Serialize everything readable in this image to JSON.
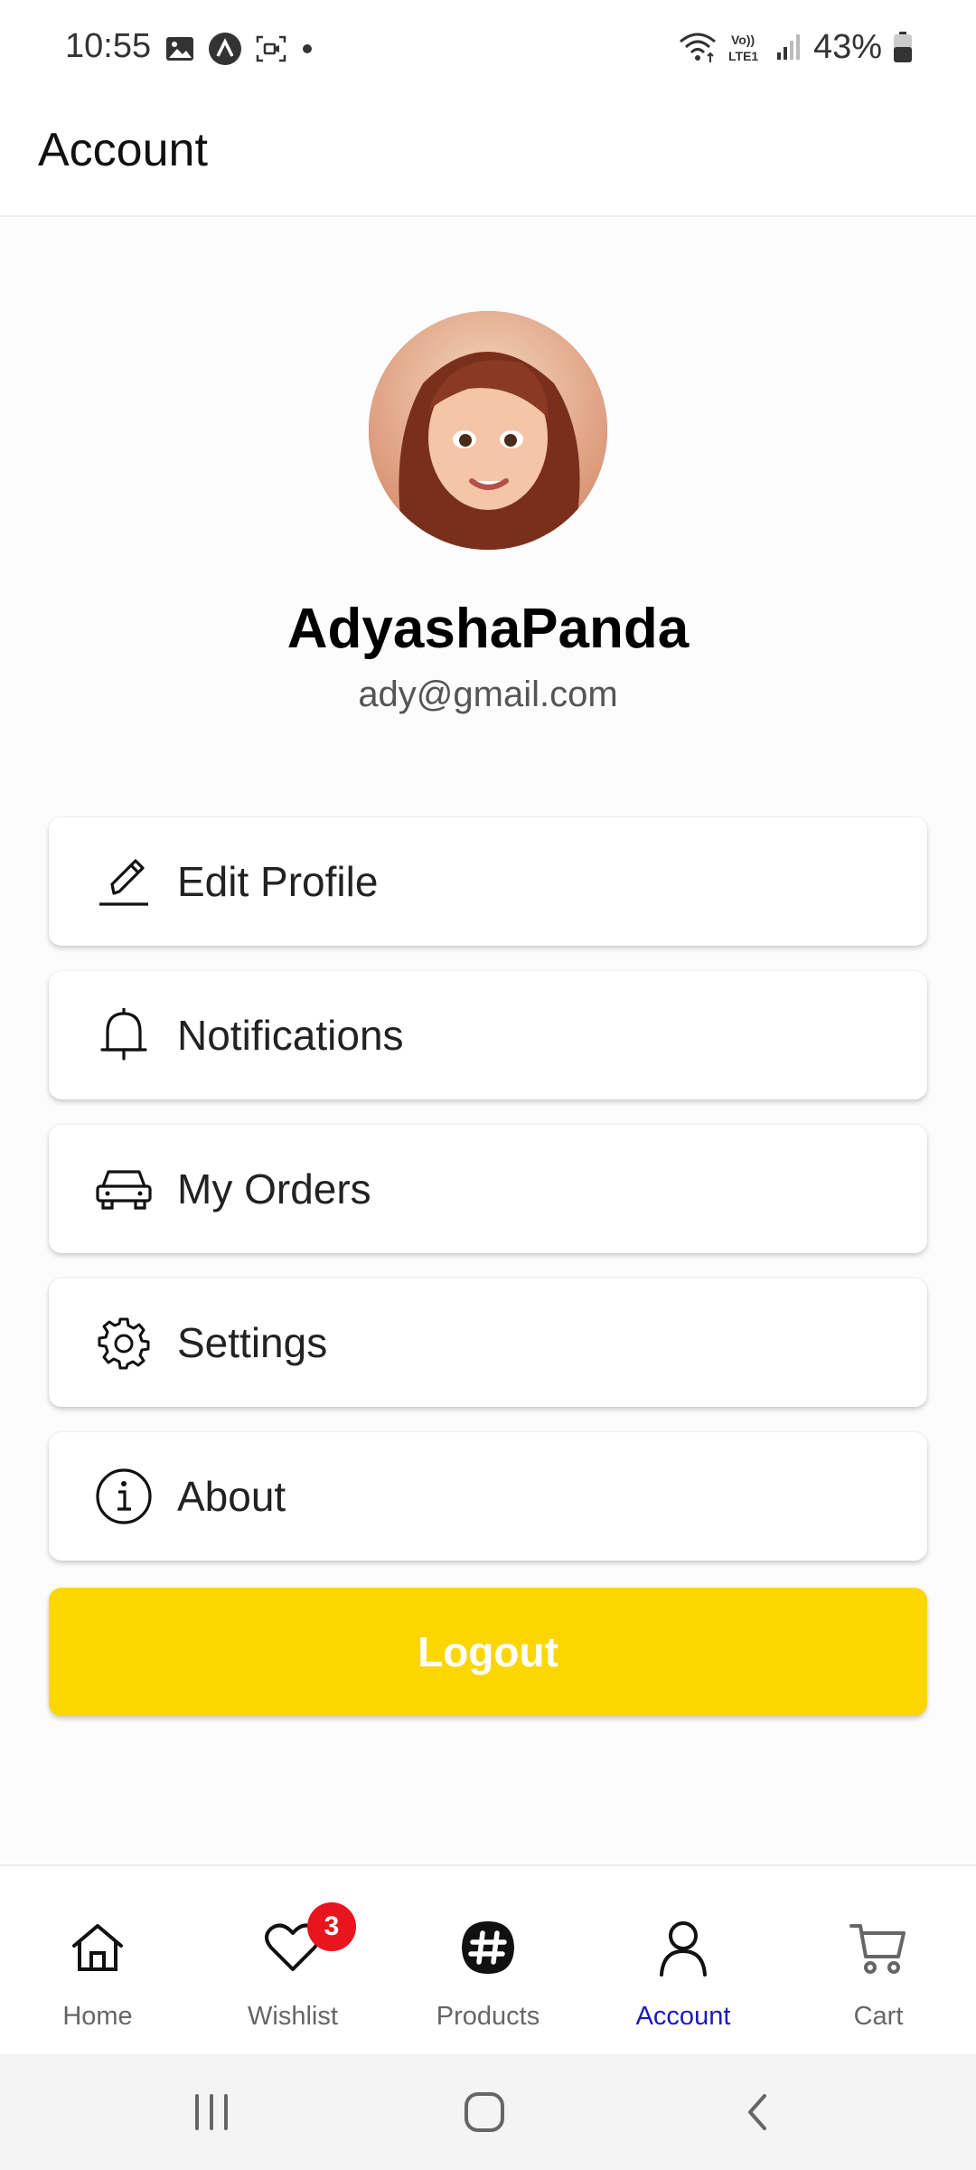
{
  "status_bar": {
    "time": "10:55",
    "battery": "43%",
    "left_icons": [
      "gallery-icon",
      "app-a-icon",
      "screen-record-icon",
      "dot-icon"
    ],
    "right_icons": [
      "wifi-icon",
      "volte-icon",
      "signal-icon",
      "battery-icon"
    ],
    "volte_text": "Vo)) LTE1"
  },
  "header": {
    "title": "Account"
  },
  "profile": {
    "name": "AdyashaPanda",
    "email": "ady@gmail.com"
  },
  "menu": [
    {
      "label": "Edit Profile",
      "icon": "pencil-icon"
    },
    {
      "label": "Notifications",
      "icon": "bell-icon"
    },
    {
      "label": "My Orders",
      "icon": "car-icon"
    },
    {
      "label": "Settings",
      "icon": "gear-icon"
    },
    {
      "label": "About",
      "icon": "info-icon"
    }
  ],
  "logout": {
    "label": "Logout",
    "color": "#FCD600"
  },
  "bottom_nav": {
    "active": "Account",
    "active_color": "#1A1AB8",
    "items": [
      {
        "label": "Home",
        "icon": "home-icon"
      },
      {
        "label": "Wishlist",
        "icon": "heart-icon",
        "badge": "3"
      },
      {
        "label": "Products",
        "icon": "products-icon"
      },
      {
        "label": "Account",
        "icon": "user-icon"
      },
      {
        "label": "Cart",
        "icon": "cart-icon"
      }
    ]
  },
  "system_nav": [
    "recents-button",
    "home-button",
    "back-button"
  ]
}
